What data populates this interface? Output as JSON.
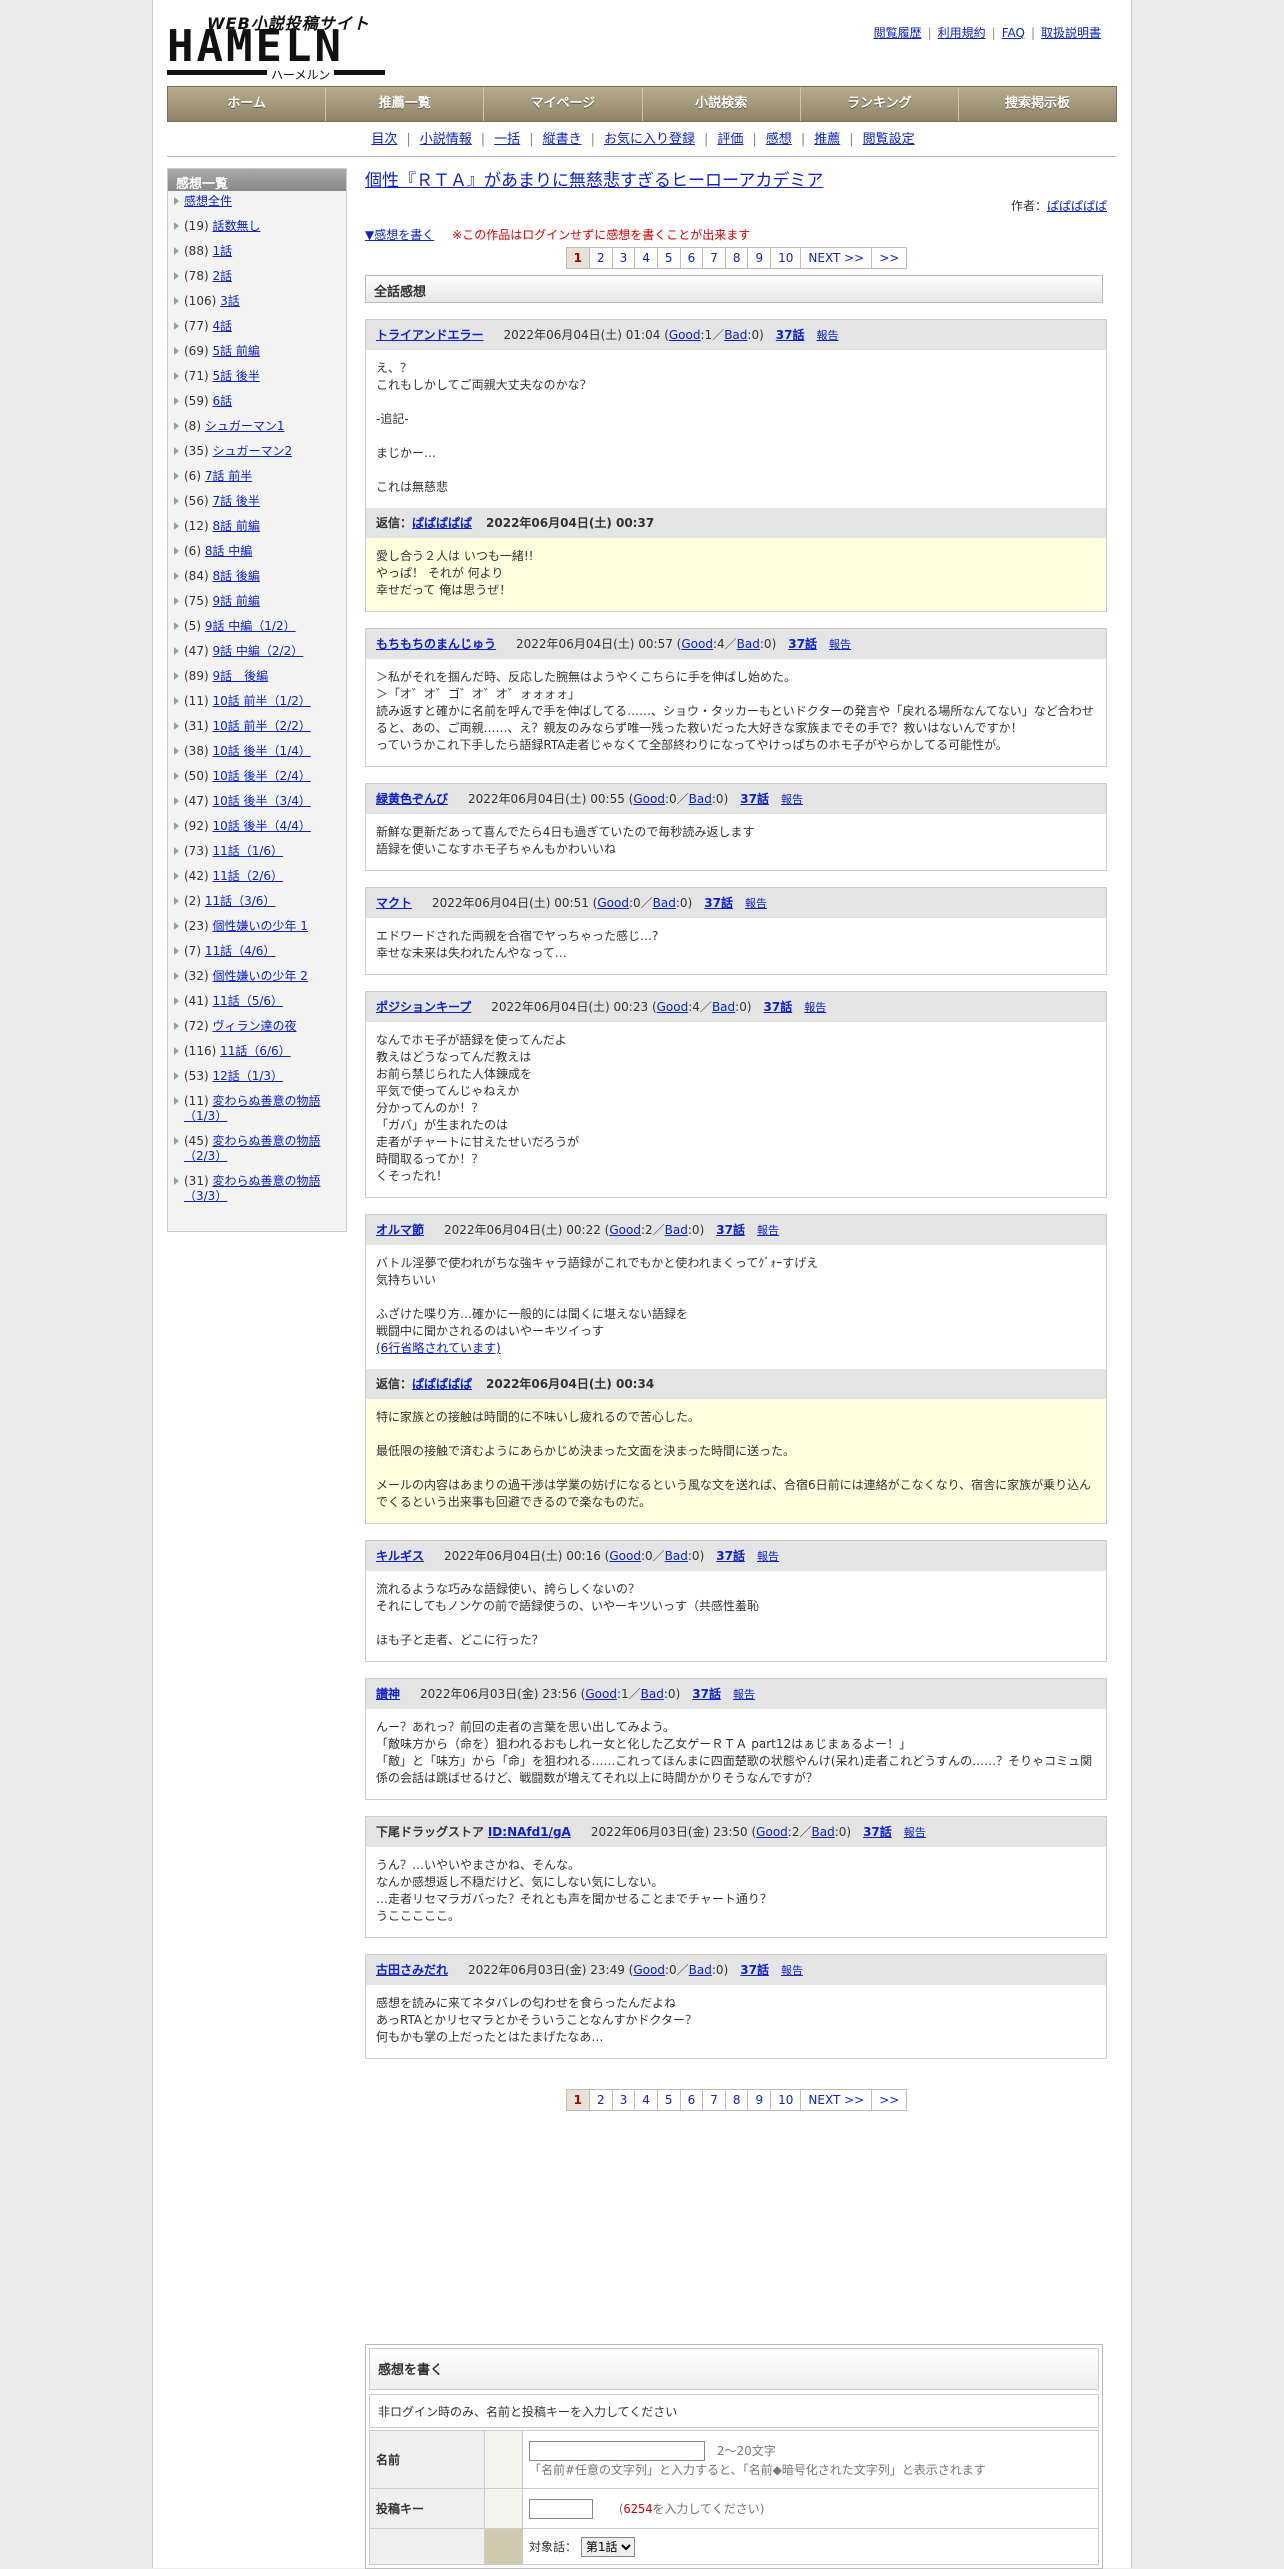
{
  "logo": {
    "tagline": "WEB小説投稿サイト",
    "brand": "HAMELN",
    "kana": "ハーメルン"
  },
  "toplinks": [
    "閲覧履歴",
    "利用規約",
    "FAQ",
    "取扱説明書"
  ],
  "global_nav": [
    "ホーム",
    "推薦一覧",
    "マイページ",
    "小説検索",
    "ランキング",
    "捜索掲示板"
  ],
  "sub_nav": [
    "目次",
    "小説情報",
    "一括",
    "縦書き",
    "お気に入り登録",
    "評価",
    "感想",
    "推薦",
    "閲覧設定"
  ],
  "sidebar": {
    "title": "感想一覧",
    "items": [
      {
        "count": "",
        "label": "感想全件"
      },
      {
        "count": "(19)",
        "label": "話数無し"
      },
      {
        "count": "(88)",
        "label": "1話"
      },
      {
        "count": "(78)",
        "label": "2話"
      },
      {
        "count": "(106)",
        "label": "3話"
      },
      {
        "count": "(77)",
        "label": "4話"
      },
      {
        "count": "(69)",
        "label": "5話 前編"
      },
      {
        "count": "(71)",
        "label": "5話 後半"
      },
      {
        "count": "(59)",
        "label": "6話"
      },
      {
        "count": "(8)",
        "label": "シュガーマン1"
      },
      {
        "count": "(35)",
        "label": "シュガーマン2"
      },
      {
        "count": "(6)",
        "label": "7話 前半"
      },
      {
        "count": "(56)",
        "label": "7話 後半"
      },
      {
        "count": "(12)",
        "label": "8話 前編"
      },
      {
        "count": "(6)",
        "label": "8話 中編"
      },
      {
        "count": "(84)",
        "label": "8話 後編"
      },
      {
        "count": "(75)",
        "label": "9話 前編"
      },
      {
        "count": "(5)",
        "label": "9話 中編（1/2）"
      },
      {
        "count": "(47)",
        "label": "9話 中編（2/2）"
      },
      {
        "count": "(89)",
        "label": "9話　後編"
      },
      {
        "count": "(11)",
        "label": "10話 前半（1/2）"
      },
      {
        "count": "(31)",
        "label": "10話 前半（2/2）"
      },
      {
        "count": "(38)",
        "label": "10話 後半（1/4）"
      },
      {
        "count": "(50)",
        "label": "10話 後半（2/4）"
      },
      {
        "count": "(47)",
        "label": "10話 後半（3/4）"
      },
      {
        "count": "(92)",
        "label": "10話 後半（4/4）"
      },
      {
        "count": "(73)",
        "label": "11話（1/6）"
      },
      {
        "count": "(42)",
        "label": "11話（2/6）"
      },
      {
        "count": "(2)",
        "label": "11話（3/6）"
      },
      {
        "count": "(23)",
        "label": "個性嫌いの少年 1"
      },
      {
        "count": "(7)",
        "label": "11話（4/6）"
      },
      {
        "count": "(32)",
        "label": "個性嫌いの少年 2"
      },
      {
        "count": "(41)",
        "label": "11話（5/6）"
      },
      {
        "count": "(72)",
        "label": "ヴィラン達の夜"
      },
      {
        "count": "(116)",
        "label": "11話（6/6）"
      },
      {
        "count": "(53)",
        "label": "12話（1/3）"
      },
      {
        "count": "(11)",
        "label": "変わらぬ善意の物語（1/3）"
      },
      {
        "count": "(45)",
        "label": "変わらぬ善意の物語（2/3）"
      },
      {
        "count": "(31)",
        "label": "変わらぬ善意の物語（3/3）"
      }
    ]
  },
  "main": {
    "title": "個性『ＲＴＡ』があまりに無慈悲すぎるヒーローアカデミア",
    "author_label": "作者：",
    "author": "ぱぱぱぱぱ",
    "write_link": "▼感想を書く",
    "warning": "※この作品はログインせずに感想を書くことが出来ます",
    "pager": {
      "pages": [
        "1",
        "2",
        "3",
        "4",
        "5",
        "6",
        "7",
        "8",
        "9",
        "10"
      ],
      "current": "1",
      "next": "NEXT >>",
      "last": ">>"
    },
    "section_title": "全話感想"
  },
  "reviews": [
    {
      "name": "トライアンドエラー",
      "name_link": true,
      "id": "",
      "date": "2022年06月04日(土) 01:04",
      "good": "1",
      "bad": "0",
      "episode": "37話",
      "report": "報告",
      "body": [
        "え、？",
        "これもしかしてご両親大丈夫なのかな？",
        "",
        "-追記-",
        "",
        "まじかー…",
        "",
        "これは無慈悲"
      ],
      "reply": {
        "label": "返信：",
        "author": "ぱぱぱぱぱ",
        "date": "2022年06月04日(土) 00:37",
        "body": [
          "愛し合う２人は いつも一緒!!",
          "やっぱ！ それが 何より",
          "幸せだって 俺は思うぜ！"
        ]
      }
    },
    {
      "name": "もちもちのまんじゅう",
      "name_link": true,
      "id": "",
      "date": "2022年06月04日(土) 00:57",
      "good": "4",
      "bad": "0",
      "episode": "37話",
      "report": "報告",
      "body": [
        "＞私がそれを掴んだ時、反応した腕無はようやくこちらに手を伸ばし始めた。",
        "＞「オ゛オ゛ゴ゛オ゛オ゛ォォォォ」",
        "読み返すと確かに名前を呼んで手を伸ばしてる……、ショウ・タッカーもといドクターの発言や「戻れる場所なんてない」など合わせると、あの、ご両親……、え？親友のみならず唯一残った救いだった大好きな家族までその手で？救いはないんですか！",
        "っていうかこれ下手したら語録RTA走者じゃなくて全部終わりになってやけっぱちのホモ子がやらかしてる可能性が。"
      ],
      "reply": null
    },
    {
      "name": "緑黄色ぞんび",
      "name_link": true,
      "id": "",
      "date": "2022年06月04日(土) 00:55",
      "good": "0",
      "bad": "0",
      "episode": "37話",
      "report": "報告",
      "body": [
        "新鮮な更新だあって喜んでたら4日も過ぎていたので毎秒読み返します",
        "語録を使いこなすホモ子ちゃんもかわいいね"
      ],
      "reply": null
    },
    {
      "name": "マクト",
      "name_link": true,
      "id": "",
      "date": "2022年06月04日(土) 00:51",
      "good": "0",
      "bad": "0",
      "episode": "37話",
      "report": "報告",
      "body": [
        "エドワードされた両親を合宿でヤっちゃった感じ…?",
        "幸せな未来は失われたんやなって…"
      ],
      "reply": null
    },
    {
      "name": "ポジションキープ",
      "name_link": true,
      "id": "",
      "date": "2022年06月04日(土) 00:23",
      "good": "4",
      "bad": "0",
      "episode": "37話",
      "report": "報告",
      "body": [
        "なんでホモ子が語録を使ってんだよ",
        "教えはどうなってんだ教えは",
        "お前ら禁じられた人体錬成を",
        "平気で使ってんじゃねえか",
        "分かってんのか！？",
        "「ガバ」が生まれたのは",
        "走者がチャートに甘えたせいだろうが",
        "時間取るってか！？",
        "くそったれ！"
      ],
      "reply": null
    },
    {
      "name": "オルマ節",
      "name_link": true,
      "id": "",
      "date": "2022年06月04日(土) 00:22",
      "good": "2",
      "bad": "0",
      "episode": "37話",
      "report": "報告",
      "body": [
        "バトル淫夢で使われがちな強キャラ語録がこれでもかと使われまくってｸﾞｫｰすげえ",
        "気持ちいい",
        "",
        "ふざけた喋り方…確かに一般的には聞くに堪えない語録を",
        "戦闘中に聞かされるのはいやーキツイっす"
      ],
      "more": "(6行省略されています)",
      "reply": {
        "label": "返信：",
        "author": "ぱぱぱぱぱ",
        "date": "2022年06月04日(土) 00:34",
        "body": [
          "特に家族との接触は時間的に不味いし疲れるので苦心した。",
          "",
          "最低限の接触で済むようにあらかじめ決まった文面を決まった時間に送った。",
          "",
          "メールの内容はあまりの過干渉は学業の妨げになるという風な文を送れば、合宿6日前には連絡がこなくなり、宿舎に家族が乗り込んでくるという出来事も回避できるので楽なものだ。"
        ]
      }
    },
    {
      "name": "キルギス",
      "name_link": true,
      "id": "",
      "date": "2022年06月04日(土) 00:16",
      "good": "0",
      "bad": "0",
      "episode": "37話",
      "report": "報告",
      "body": [
        "流れるような巧みな語録使い、誇らしくないの？",
        "それにしてもノンケの前で語録使うの、いやーキツいっす（共感性羞恥",
        "",
        "ほも子と走者、どこに行った？"
      ],
      "reply": null
    },
    {
      "name": "讃神",
      "name_link": true,
      "id": "",
      "date": "2022年06月03日(金) 23:56",
      "good": "1",
      "bad": "0",
      "episode": "37話",
      "report": "報告",
      "body": [
        "んー？あれっ？前回の走者の言葉を思い出してみよう。",
        "「敵味方から（命を）狙われるおもしれー女と化した乙女ゲーＲＴＡ part12はぁじまぁるよー！」",
        "「敵」と「味方」から「命」を狙われる……これってほんまに四面楚歌の状態やんけ(呆れ)走者これどうすんの……？そりゃコミュ関係の会話は跳ばせるけど、戦闘数が増えてそれ以上に時間かかりそうなんですが？"
      ],
      "reply": null
    },
    {
      "name": "下尾ドラッグストア",
      "name_link": false,
      "id": "ID:NAfd1/gA",
      "date": "2022年06月03日(金) 23:50",
      "good": "2",
      "bad": "0",
      "episode": "37話",
      "report": "報告",
      "body": [
        "うん？…いやいやまさかね、そんな。",
        "なんか感想返し不穏だけど、気にしない気にしない。",
        "…走者リセマラガバった？それとも声を聞かせることまでチャート通り？",
        "うこここここ。"
      ],
      "reply": null
    },
    {
      "name": "古田さみだれ",
      "name_link": true,
      "id": "",
      "date": "2022年06月03日(金) 23:49",
      "good": "0",
      "bad": "0",
      "episode": "37話",
      "report": "報告",
      "body": [
        "感想を読みに来てネタバレの匂わせを食らったんだよね",
        "あっRTAとかリセマラとかそういうことなんすかドクター？",
        "何もかも掌の上だったとはたまげたなあ…"
      ],
      "reply": null
    }
  ],
  "form": {
    "title": "感想を書く",
    "note": "非ログイン時のみ、名前と投稿キーを入力してください",
    "name_label": "名前",
    "name_value": "",
    "name_limit": "2～20文字",
    "name_hint": "「名前#任意の文字列」と入力すると、「名前◆暗号化された文字列」と表示されます",
    "key_label": "投稿キー",
    "key_value": "",
    "key_code": "6254",
    "key_hint": "を入力してください)",
    "key_open": "(",
    "target_label": "対象話：",
    "target_value": "第1話"
  }
}
